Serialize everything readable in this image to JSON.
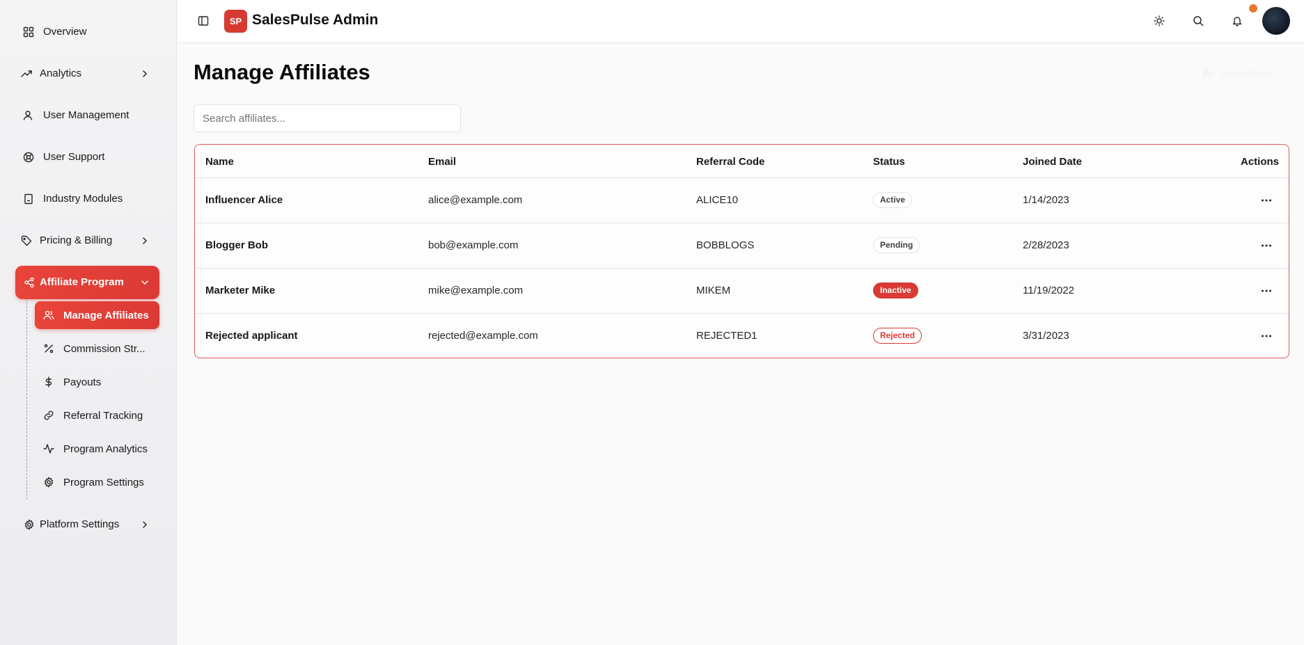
{
  "app": {
    "logo_text": "SP",
    "title": "SalesPulse Admin"
  },
  "sidebar": {
    "items": [
      {
        "label": "Overview",
        "icon": "grid-icon"
      },
      {
        "label": "Analytics",
        "icon": "trending-up-icon",
        "expandable": true
      },
      {
        "label": "User Management",
        "icon": "user-icon"
      },
      {
        "label": "User Support",
        "icon": "lifebuoy-icon"
      },
      {
        "label": "Industry Modules",
        "icon": "building-icon"
      },
      {
        "label": "Pricing & Billing",
        "icon": "tag-icon",
        "expandable": true
      },
      {
        "label": "Affiliate Program",
        "icon": "share-icon",
        "expanded": true,
        "active": true
      },
      {
        "label": "Platform Settings",
        "icon": "gear-icon",
        "expandable": true
      }
    ],
    "affiliate_sub_items": [
      {
        "label": "Manage Affiliates",
        "icon": "users-icon",
        "active": true
      },
      {
        "label": "Commission Str...",
        "icon": "percent-icon"
      },
      {
        "label": "Payouts",
        "icon": "dollar-icon"
      },
      {
        "label": "Referral Tracking",
        "icon": "link-icon"
      },
      {
        "label": "Program Analytics",
        "icon": "activity-icon"
      },
      {
        "label": "Program Settings",
        "icon": "gear-icon"
      }
    ]
  },
  "header": {
    "icons": [
      "sidebar-toggle-icon",
      "sun-icon",
      "search-icon",
      "bell-icon"
    ],
    "has_notifications": true
  },
  "main": {
    "title": "Manage Affiliates",
    "add_button_label": "Add Affiliate",
    "search_placeholder": "Search affiliates...",
    "table": {
      "columns": [
        "Name",
        "Email",
        "Referral Code",
        "Status",
        "Joined Date",
        "Actions"
      ],
      "rows": [
        {
          "name": "Influencer Alice",
          "email": "alice@example.com",
          "code": "ALICE10",
          "status": "Active",
          "joined": "1/14/2023"
        },
        {
          "name": "Blogger Bob",
          "email": "bob@example.com",
          "code": "BOBBLOGS",
          "status": "Pending",
          "joined": "2/28/2023"
        },
        {
          "name": "Marketer Mike",
          "email": "mike@example.com",
          "code": "MIKEM",
          "status": "Inactive",
          "joined": "11/19/2022"
        },
        {
          "name": "Rejected applicant",
          "email": "rejected@example.com",
          "code": "REJECTED1",
          "status": "Rejected",
          "joined": "3/31/2023"
        }
      ]
    }
  },
  "colors": {
    "accent": "#dc3a35",
    "notification_dot": "#ea7a2f",
    "table_border": "#e05a55"
  }
}
